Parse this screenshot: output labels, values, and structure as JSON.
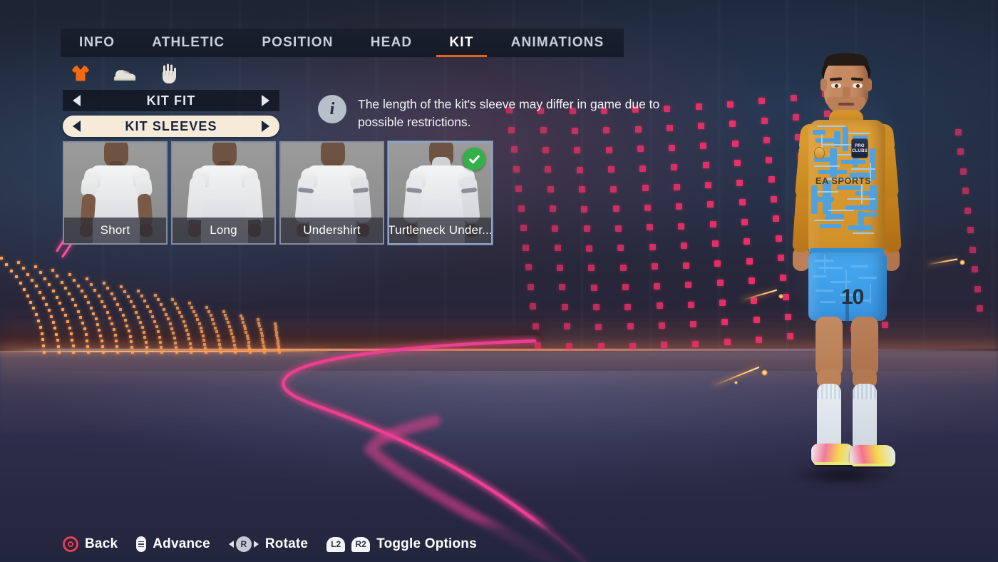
{
  "tabs": [
    {
      "label": "INFO",
      "active": false
    },
    {
      "label": "ATHLETIC",
      "active": false
    },
    {
      "label": "POSITION",
      "active": false
    },
    {
      "label": "HEAD",
      "active": false
    },
    {
      "label": "KIT",
      "active": true
    },
    {
      "label": "ANIMATIONS",
      "active": false
    }
  ],
  "subcategories": [
    {
      "icon": "jersey-icon",
      "active": true
    },
    {
      "icon": "boot-icon",
      "active": false
    },
    {
      "icon": "glove-icon",
      "active": false
    }
  ],
  "options": {
    "kit_fit": {
      "label": "KIT FIT",
      "selected": false
    },
    "kit_sleeves": {
      "label": "KIT SLEEVES",
      "selected": true
    }
  },
  "info": {
    "icon": "info-icon",
    "text": "The length of the kit's sleeve may differ in game due to possible restrictions."
  },
  "cards": [
    {
      "label": "Short",
      "selected": false,
      "sleeve": "short"
    },
    {
      "label": "Long",
      "selected": false,
      "sleeve": "long"
    },
    {
      "label": "Undershirt",
      "selected": false,
      "sleeve": "undershirt"
    },
    {
      "label": "Turtleneck Under...",
      "selected": true,
      "sleeve": "turtleneck"
    }
  ],
  "legend": [
    {
      "icon": "circle-button-icon",
      "label": "Back"
    },
    {
      "icon": "touchpad-icon",
      "label": "Advance"
    },
    {
      "icon": "right-stick-icon",
      "glyph": "R",
      "label": "Rotate"
    },
    {
      "icon": "l2-r2-trigger-icon",
      "glyph_left": "L2",
      "glyph_right": "R2",
      "label": "Toggle Options"
    }
  ],
  "player": {
    "sponsor_text": "EA SPORTS",
    "badge_line1": "PRO",
    "badge_line2": "CLUBS",
    "shorts_number": "10"
  },
  "colors": {
    "accent_orange": "#e8621c",
    "selected_pill": "#f6ebd8",
    "selected_pill_text": "#17233f",
    "check_green": "#35b048",
    "back_red": "#e83d52",
    "jersey_orange": "#d8992f",
    "jersey_blue": "#4aa2e8",
    "shorts_blue": "#3e9ee8",
    "dot_pink": "#f4306a"
  }
}
